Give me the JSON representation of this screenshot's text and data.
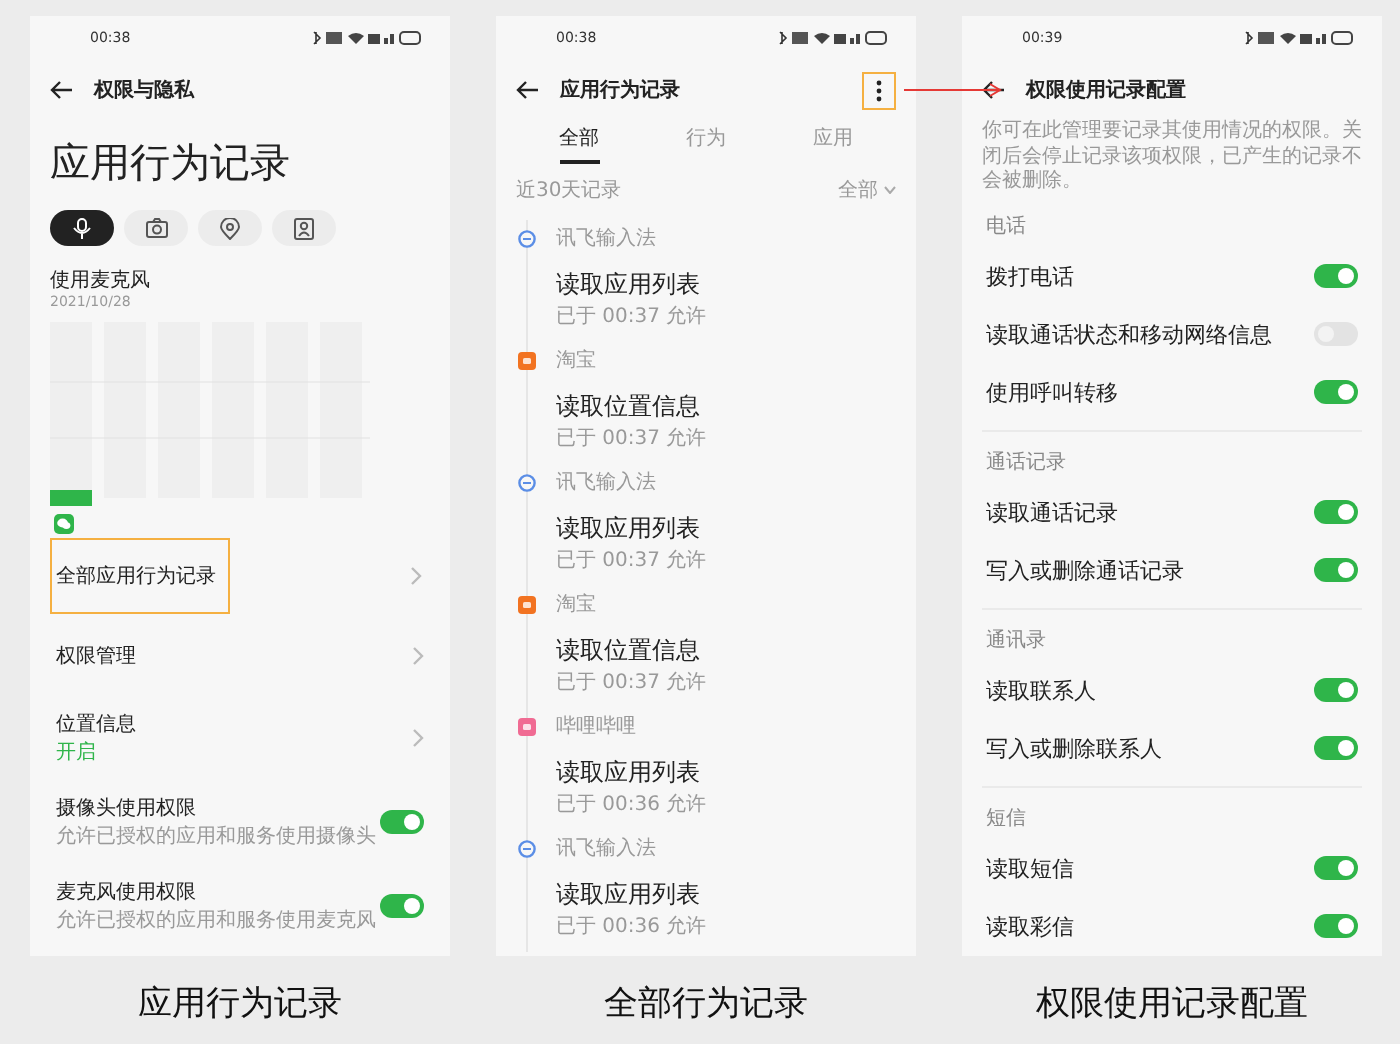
{
  "app_behavior_screen": {
    "time": "00:38",
    "back_title": "权限与隐私",
    "heading": "应用行为记录",
    "permission_tabs": [
      {
        "kind": "microphone",
        "selected": true
      },
      {
        "kind": "camera",
        "selected": false
      },
      {
        "kind": "location",
        "selected": false
      },
      {
        "kind": "contacts",
        "selected": false
      }
    ],
    "usage_title": "使用麦克风",
    "usage_date": "2021/10/28",
    "menu": [
      {
        "kind": "link",
        "label": "全部应用行为记录",
        "highlighted": true
      },
      {
        "kind": "link",
        "label": "权限管理",
        "highlighted": false
      },
      {
        "kind": "link",
        "label": "位置信息",
        "sub": "开启",
        "highlighted": false
      },
      {
        "kind": "toggle",
        "label": "摄像头使用权限",
        "sub": "允许已授权的应用和服务使用摄像头",
        "on": true,
        "highlighted": false
      },
      {
        "kind": "toggle",
        "label": "麦克风使用权限",
        "sub": "允许已授权的应用和服务使用麦克风",
        "on": true,
        "highlighted": false
      }
    ]
  },
  "all_records_screen": {
    "time": "00:38",
    "title": "应用行为记录",
    "menu_highlighted": true,
    "tabs": [
      {
        "label": "全部",
        "selected": true
      },
      {
        "label": "行为",
        "selected": false
      },
      {
        "label": "应用",
        "selected": false
      }
    ],
    "range_label": "近30天记录",
    "filter": "全部",
    "records": [
      {
        "app": "讯飞输入法",
        "kind": "round",
        "color": "#5b8ee6",
        "action": "读取应用列表",
        "time": "已于 00:37 允许"
      },
      {
        "app": "淘宝",
        "kind": "tile",
        "color": "#f27321",
        "action": "读取位置信息",
        "time": "已于 00:37 允许"
      },
      {
        "app": "讯飞输入法",
        "kind": "round",
        "color": "#5b8ee6",
        "action": "读取应用列表",
        "time": "已于 00:37 允许"
      },
      {
        "app": "淘宝",
        "kind": "tile",
        "color": "#f27321",
        "action": "读取位置信息",
        "time": "已于 00:37 允许"
      },
      {
        "app": "哔哩哔哩",
        "kind": "tile",
        "color": "#f06b93",
        "action": "读取应用列表",
        "time": "已于 00:36 允许"
      },
      {
        "app": "讯飞输入法",
        "kind": "round",
        "color": "#5b8ee6",
        "action": "读取应用列表",
        "time": "已于 00:36 允许"
      }
    ]
  },
  "config_screen": {
    "time": "00:39",
    "title": "权限使用记录配置",
    "description": "你可在此管理要记录其使用情况的权限。关闭后会停止记录该项权限，已产生的记录不会被删除。",
    "sections": [
      {
        "title": "电话",
        "items": [
          {
            "label": "拨打电话",
            "on": true
          },
          {
            "label": "读取通话状态和移动网络信息",
            "on": false
          },
          {
            "label": "使用呼叫转移",
            "on": true
          }
        ]
      },
      {
        "title": "通话记录",
        "items": [
          {
            "label": "读取通话记录",
            "on": true
          },
          {
            "label": "写入或删除通话记录",
            "on": true
          }
        ]
      },
      {
        "title": "通讯录",
        "items": [
          {
            "label": "读取联系人",
            "on": true
          },
          {
            "label": "写入或删除联系人",
            "on": true
          }
        ]
      },
      {
        "title": "短信",
        "items": [
          {
            "label": "读取短信",
            "on": true
          },
          {
            "label": "读取彩信",
            "on": true
          }
        ]
      }
    ]
  },
  "captions": [
    "应用行为记录",
    "全部行为记录",
    "权限使用记录配置"
  ]
}
